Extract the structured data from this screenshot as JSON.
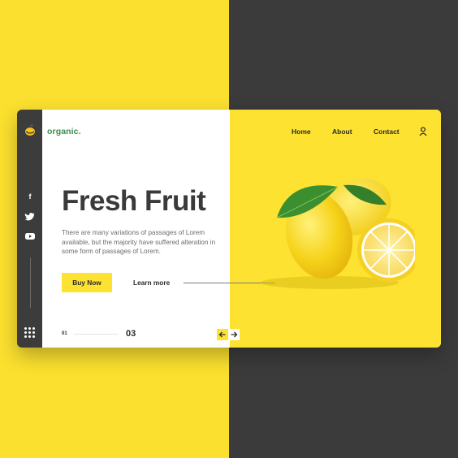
{
  "brand": {
    "name": "organic.",
    "color": "#3b8b4c",
    "icon": "lemon-logo-icon"
  },
  "nav": {
    "items": [
      {
        "label": "Home"
      },
      {
        "label": "About"
      },
      {
        "label": "Contact"
      }
    ],
    "user_icon": "user-icon"
  },
  "social": {
    "items": [
      "f",
      "twitter-icon",
      "youtube-icon"
    ]
  },
  "hero": {
    "title": "Fresh Fruit",
    "description": "There are many variations of passages of Lorem available, but the majority have suffered alteration in some form of passages of Lorem.",
    "primary_button": "Buy Now",
    "secondary_link": "Learn more"
  },
  "pagination": {
    "current": "01",
    "total": "03"
  },
  "colors": {
    "accent": "#fde232",
    "dark": "#3b3b3b",
    "white": "#ffffff",
    "brand_green": "#3b8b4c"
  }
}
